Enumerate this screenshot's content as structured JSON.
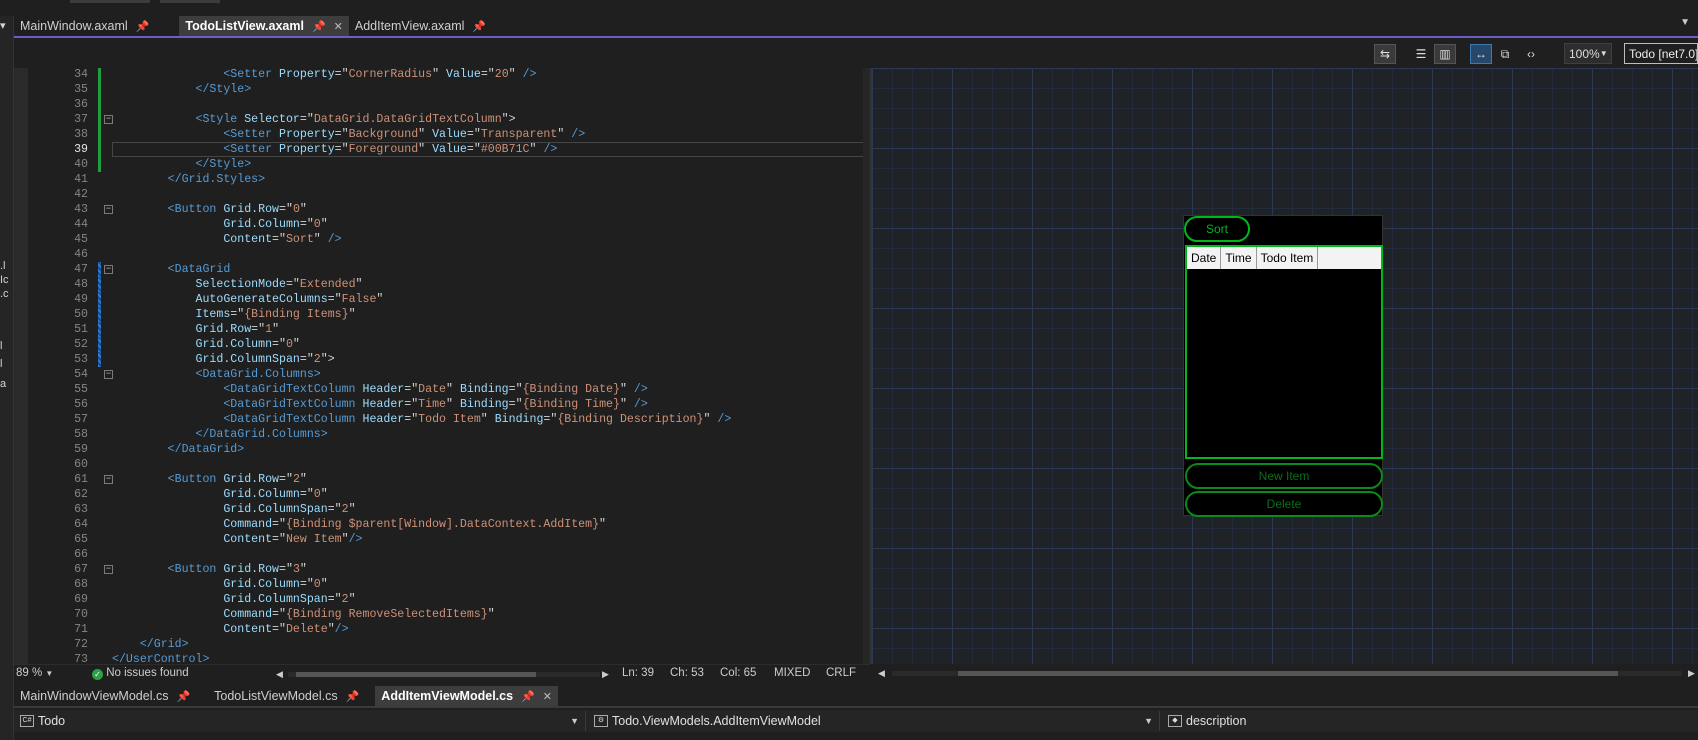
{
  "left_panel_fragments": [
    ".l",
    "Ic",
    ".c",
    "l",
    "l",
    "a"
  ],
  "doc_tabs": [
    {
      "label": "MainWindow.axaml",
      "active": false,
      "closable": false
    },
    {
      "label": "TodoListView.axaml",
      "active": true,
      "closable": true
    },
    {
      "label": "AddItemView.axaml",
      "active": false,
      "closable": false
    }
  ],
  "pin_glyph": "📌",
  "close_glyph": "✕",
  "preview_toolbar": {
    "zoom": "100%",
    "target": "Todo [net7.0]"
  },
  "code_lines": [
    {
      "n": "34",
      "chg": "saved",
      "fold": false,
      "segs": [
        [
          "t",
          "                "
        ],
        [
          "tag",
          "<Setter"
        ],
        [
          "t",
          " "
        ],
        [
          "attr",
          "Property"
        ],
        [
          "t",
          "=\""
        ],
        [
          "str",
          "CornerRadius"
        ],
        [
          "t",
          "\" "
        ],
        [
          "attr",
          "Value"
        ],
        [
          "t",
          "=\""
        ],
        [
          "str",
          "20"
        ],
        [
          "t",
          "\" "
        ],
        [
          "tag",
          "/>"
        ]
      ]
    },
    {
      "n": "35",
      "chg": "saved",
      "fold": false,
      "segs": [
        [
          "t",
          "            "
        ],
        [
          "tag",
          "</Style>"
        ]
      ]
    },
    {
      "n": "36",
      "chg": "saved",
      "fold": false,
      "segs": []
    },
    {
      "n": "37",
      "chg": "saved",
      "fold": true,
      "segs": [
        [
          "t",
          "            "
        ],
        [
          "tag",
          "<Style"
        ],
        [
          "t",
          " "
        ],
        [
          "attr",
          "Selector"
        ],
        [
          "t",
          "=\""
        ],
        [
          "str",
          "DataGrid.DataGridTextColumn"
        ],
        [
          "t",
          "\">"
        ]
      ]
    },
    {
      "n": "38",
      "chg": "saved",
      "fold": false,
      "segs": [
        [
          "t",
          "                "
        ],
        [
          "tag",
          "<Setter"
        ],
        [
          "t",
          " "
        ],
        [
          "attr",
          "Property"
        ],
        [
          "t",
          "=\""
        ],
        [
          "str",
          "Background"
        ],
        [
          "t",
          "\" "
        ],
        [
          "attr",
          "Value"
        ],
        [
          "t",
          "=\""
        ],
        [
          "str",
          "Transparent"
        ],
        [
          "t",
          "\" "
        ],
        [
          "tag",
          "/>"
        ]
      ]
    },
    {
      "n": "39",
      "chg": "saved",
      "fold": false,
      "current": true,
      "segs": [
        [
          "t",
          "                "
        ],
        [
          "tag",
          "<Setter"
        ],
        [
          "t",
          " "
        ],
        [
          "attr",
          "Property"
        ],
        [
          "t",
          "=\""
        ],
        [
          "str",
          "Foreground"
        ],
        [
          "t",
          "\" "
        ],
        [
          "attr",
          "Value"
        ],
        [
          "t",
          "=\""
        ],
        [
          "str",
          "#00B71C"
        ],
        [
          "t",
          "\" "
        ],
        [
          "tag",
          "/>"
        ]
      ]
    },
    {
      "n": "40",
      "chg": "saved",
      "fold": false,
      "segs": [
        [
          "t",
          "            "
        ],
        [
          "tag",
          "</Style>"
        ]
      ]
    },
    {
      "n": "41",
      "chg": "",
      "fold": false,
      "segs": [
        [
          "t",
          "        "
        ],
        [
          "tag",
          "</Grid.Styles>"
        ]
      ]
    },
    {
      "n": "42",
      "chg": "",
      "fold": false,
      "segs": []
    },
    {
      "n": "43",
      "chg": "",
      "fold": true,
      "segs": [
        [
          "t",
          "        "
        ],
        [
          "tag",
          "<Button"
        ],
        [
          "t",
          " "
        ],
        [
          "attr",
          "Grid.Row"
        ],
        [
          "t",
          "=\""
        ],
        [
          "str",
          "0"
        ],
        [
          "t",
          "\""
        ]
      ]
    },
    {
      "n": "44",
      "chg": "",
      "fold": false,
      "segs": [
        [
          "t",
          "                "
        ],
        [
          "attr",
          "Grid.Column"
        ],
        [
          "t",
          "=\""
        ],
        [
          "str",
          "0"
        ],
        [
          "t",
          "\""
        ]
      ]
    },
    {
      "n": "45",
      "chg": "",
      "fold": false,
      "segs": [
        [
          "t",
          "                "
        ],
        [
          "attr",
          "Content"
        ],
        [
          "t",
          "=\""
        ],
        [
          "str",
          "Sort"
        ],
        [
          "t",
          "\" "
        ],
        [
          "tag",
          "/>"
        ]
      ]
    },
    {
      "n": "46",
      "chg": "",
      "fold": false,
      "segs": []
    },
    {
      "n": "47",
      "chg": "edit",
      "fold": true,
      "segs": [
        [
          "t",
          "        "
        ],
        [
          "tag",
          "<DataGrid"
        ]
      ]
    },
    {
      "n": "48",
      "chg": "edit",
      "fold": false,
      "segs": [
        [
          "t",
          "            "
        ],
        [
          "attr",
          "SelectionMode"
        ],
        [
          "t",
          "=\""
        ],
        [
          "str",
          "Extended"
        ],
        [
          "t",
          "\""
        ]
      ]
    },
    {
      "n": "49",
      "chg": "edit",
      "fold": false,
      "segs": [
        [
          "t",
          "            "
        ],
        [
          "attr",
          "AutoGenerateColumns"
        ],
        [
          "t",
          "=\""
        ],
        [
          "str",
          "False"
        ],
        [
          "t",
          "\""
        ]
      ]
    },
    {
      "n": "50",
      "chg": "edit",
      "fold": false,
      "segs": [
        [
          "t",
          "            "
        ],
        [
          "attr",
          "Items"
        ],
        [
          "t",
          "=\""
        ],
        [
          "str",
          "{Binding Items}"
        ],
        [
          "t",
          "\""
        ]
      ]
    },
    {
      "n": "51",
      "chg": "edit",
      "fold": false,
      "segs": [
        [
          "t",
          "            "
        ],
        [
          "attr",
          "Grid.Row"
        ],
        [
          "t",
          "=\""
        ],
        [
          "str",
          "1"
        ],
        [
          "t",
          "\""
        ]
      ]
    },
    {
      "n": "52",
      "chg": "edit",
      "fold": false,
      "segs": [
        [
          "t",
          "            "
        ],
        [
          "attr",
          "Grid.Column"
        ],
        [
          "t",
          "=\""
        ],
        [
          "str",
          "0"
        ],
        [
          "t",
          "\""
        ]
      ]
    },
    {
      "n": "53",
      "chg": "edit",
      "fold": false,
      "segs": [
        [
          "t",
          "            "
        ],
        [
          "attr",
          "Grid.ColumnSpan"
        ],
        [
          "t",
          "=\""
        ],
        [
          "str",
          "2"
        ],
        [
          "t",
          "\">"
        ]
      ]
    },
    {
      "n": "54",
      "chg": "",
      "fold": true,
      "segs": [
        [
          "t",
          "            "
        ],
        [
          "tag",
          "<DataGrid.Columns>"
        ]
      ]
    },
    {
      "n": "55",
      "chg": "",
      "fold": false,
      "segs": [
        [
          "t",
          "                "
        ],
        [
          "tag",
          "<DataGridTextColumn"
        ],
        [
          "t",
          " "
        ],
        [
          "attr",
          "Header"
        ],
        [
          "t",
          "=\""
        ],
        [
          "str",
          "Date"
        ],
        [
          "t",
          "\" "
        ],
        [
          "attr",
          "Binding"
        ],
        [
          "t",
          "=\""
        ],
        [
          "str",
          "{Binding Date}"
        ],
        [
          "t",
          "\" "
        ],
        [
          "tag",
          "/>"
        ]
      ]
    },
    {
      "n": "56",
      "chg": "",
      "fold": false,
      "segs": [
        [
          "t",
          "                "
        ],
        [
          "tag",
          "<DataGridTextColumn"
        ],
        [
          "t",
          " "
        ],
        [
          "attr",
          "Header"
        ],
        [
          "t",
          "=\""
        ],
        [
          "str",
          "Time"
        ],
        [
          "t",
          "\" "
        ],
        [
          "attr",
          "Binding"
        ],
        [
          "t",
          "=\""
        ],
        [
          "str",
          "{Binding Time}"
        ],
        [
          "t",
          "\" "
        ],
        [
          "tag",
          "/>"
        ]
      ]
    },
    {
      "n": "57",
      "chg": "",
      "fold": false,
      "segs": [
        [
          "t",
          "                "
        ],
        [
          "tag",
          "<DataGridTextColumn"
        ],
        [
          "t",
          " "
        ],
        [
          "attr",
          "Header"
        ],
        [
          "t",
          "=\""
        ],
        [
          "str",
          "Todo Item"
        ],
        [
          "t",
          "\" "
        ],
        [
          "attr",
          "Binding"
        ],
        [
          "t",
          "=\""
        ],
        [
          "str",
          "{Binding Description}"
        ],
        [
          "t",
          "\" "
        ],
        [
          "tag",
          "/>"
        ]
      ]
    },
    {
      "n": "58",
      "chg": "",
      "fold": false,
      "segs": [
        [
          "t",
          "            "
        ],
        [
          "tag",
          "</DataGrid.Columns>"
        ]
      ]
    },
    {
      "n": "59",
      "chg": "",
      "fold": false,
      "segs": [
        [
          "t",
          "        "
        ],
        [
          "tag",
          "</DataGrid>"
        ]
      ]
    },
    {
      "n": "60",
      "chg": "",
      "fold": false,
      "segs": []
    },
    {
      "n": "61",
      "chg": "",
      "fold": true,
      "segs": [
        [
          "t",
          "        "
        ],
        [
          "tag",
          "<Button"
        ],
        [
          "t",
          " "
        ],
        [
          "attr",
          "Grid.Row"
        ],
        [
          "t",
          "=\""
        ],
        [
          "str",
          "2"
        ],
        [
          "t",
          "\""
        ]
      ]
    },
    {
      "n": "62",
      "chg": "",
      "fold": false,
      "segs": [
        [
          "t",
          "                "
        ],
        [
          "attr",
          "Grid.Column"
        ],
        [
          "t",
          "=\""
        ],
        [
          "str",
          "0"
        ],
        [
          "t",
          "\""
        ]
      ]
    },
    {
      "n": "63",
      "chg": "",
      "fold": false,
      "segs": [
        [
          "t",
          "                "
        ],
        [
          "attr",
          "Grid.ColumnSpan"
        ],
        [
          "t",
          "=\""
        ],
        [
          "str",
          "2"
        ],
        [
          "t",
          "\""
        ]
      ]
    },
    {
      "n": "64",
      "chg": "",
      "fold": false,
      "segs": [
        [
          "t",
          "                "
        ],
        [
          "attr",
          "Command"
        ],
        [
          "t",
          "=\""
        ],
        [
          "str",
          "{Binding $parent[Window].DataContext.AddItem}"
        ],
        [
          "t",
          "\""
        ]
      ]
    },
    {
      "n": "65",
      "chg": "",
      "fold": false,
      "segs": [
        [
          "t",
          "                "
        ],
        [
          "attr",
          "Content"
        ],
        [
          "t",
          "=\""
        ],
        [
          "str",
          "New Item"
        ],
        [
          "t",
          "\""
        ],
        [
          "tag",
          "/>"
        ]
      ]
    },
    {
      "n": "66",
      "chg": "",
      "fold": false,
      "segs": []
    },
    {
      "n": "67",
      "chg": "",
      "fold": true,
      "segs": [
        [
          "t",
          "        "
        ],
        [
          "tag",
          "<Button"
        ],
        [
          "t",
          " "
        ],
        [
          "attr",
          "Grid.Row"
        ],
        [
          "t",
          "=\""
        ],
        [
          "str",
          "3"
        ],
        [
          "t",
          "\""
        ]
      ]
    },
    {
      "n": "68",
      "chg": "",
      "fold": false,
      "segs": [
        [
          "t",
          "                "
        ],
        [
          "attr",
          "Grid.Column"
        ],
        [
          "t",
          "=\""
        ],
        [
          "str",
          "0"
        ],
        [
          "t",
          "\""
        ]
      ]
    },
    {
      "n": "69",
      "chg": "",
      "fold": false,
      "segs": [
        [
          "t",
          "                "
        ],
        [
          "attr",
          "Grid.ColumnSpan"
        ],
        [
          "t",
          "=\""
        ],
        [
          "str",
          "2"
        ],
        [
          "t",
          "\""
        ]
      ]
    },
    {
      "n": "70",
      "chg": "",
      "fold": false,
      "segs": [
        [
          "t",
          "                "
        ],
        [
          "attr",
          "Command"
        ],
        [
          "t",
          "=\""
        ],
        [
          "str",
          "{Binding RemoveSelectedItems}"
        ],
        [
          "t",
          "\""
        ]
      ]
    },
    {
      "n": "71",
      "chg": "",
      "fold": false,
      "segs": [
        [
          "t",
          "                "
        ],
        [
          "attr",
          "Content"
        ],
        [
          "t",
          "=\""
        ],
        [
          "str",
          "Delete"
        ],
        [
          "t",
          "\""
        ],
        [
          "tag",
          "/>"
        ]
      ]
    },
    {
      "n": "72",
      "chg": "",
      "fold": false,
      "segs": [
        [
          "t",
          "    "
        ],
        [
          "tag",
          "</Grid>"
        ]
      ]
    },
    {
      "n": "73",
      "chg": "",
      "fold": false,
      "segs": [
        [
          "tag",
          "</UserControl>"
        ]
      ]
    }
  ],
  "status": {
    "zoom": "89 %",
    "issues": "No issues found",
    "ln": "Ln: 39",
    "ch": "Ch: 53",
    "col": "Col: 65",
    "tabs": "MIXED",
    "eol": "CRLF"
  },
  "preview_app": {
    "sort": "Sort",
    "columns": [
      "Date",
      "Time",
      "Todo Item"
    ],
    "new_item": "New Item",
    "delete": "Delete"
  },
  "bottom_tabs": [
    {
      "label": "MainWindowViewModel.cs",
      "active": false,
      "closable": false
    },
    {
      "label": "TodoListViewModel.cs",
      "active": false,
      "closable": false
    },
    {
      "label": "AddItemViewModel.cs",
      "active": true,
      "closable": true
    }
  ],
  "nav_bar": {
    "project": "Todo",
    "type": "Todo.ViewModels.AddItemViewModel",
    "member": "description"
  },
  "colors": {
    "accent_green": "#00B71C",
    "tab_accent": "#6A5EC8",
    "tag": "#569CD6",
    "attr": "#9CDCFE",
    "string": "#CE9178"
  }
}
